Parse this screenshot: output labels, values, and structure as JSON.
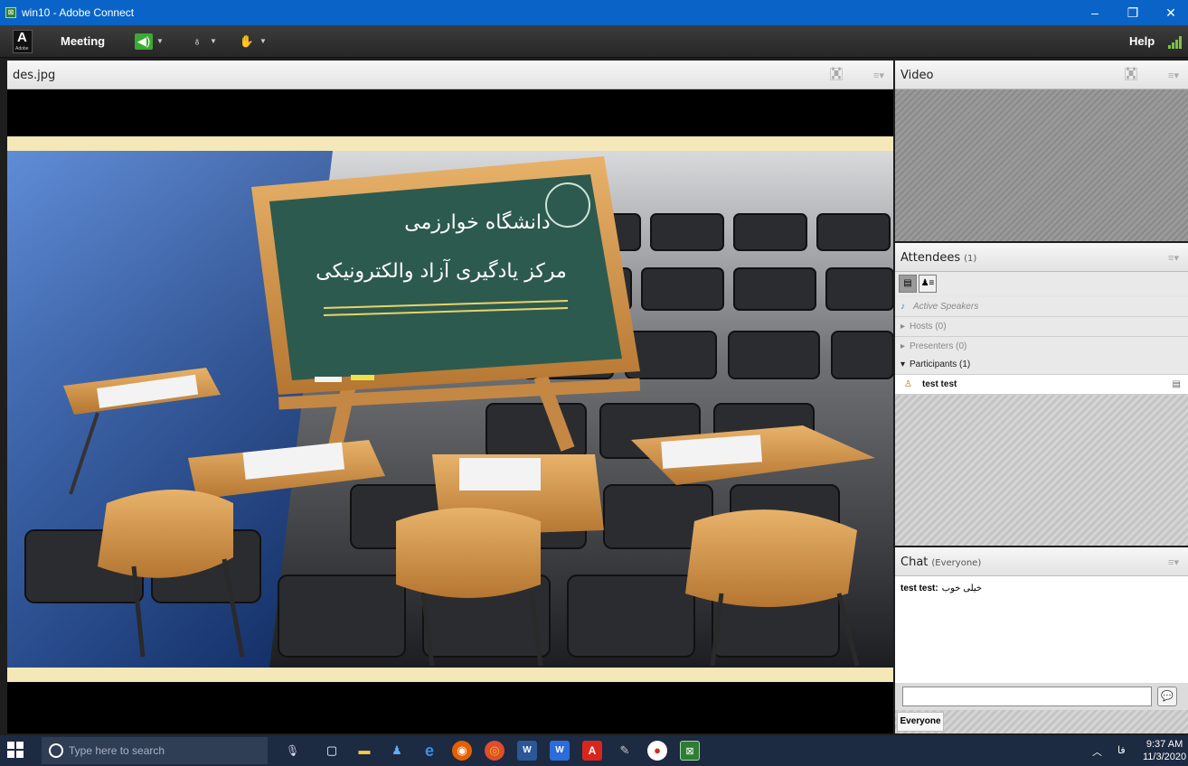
{
  "window": {
    "title": "win10 - Adobe Connect",
    "icons": [
      "minimize-icon",
      "restore-icon",
      "close-icon"
    ]
  },
  "menubar": {
    "logo_letter": "A",
    "logo_sub": "Adobe",
    "meeting_label": "Meeting",
    "speaker_icon": "speaker-icon",
    "mic_icon": "microphone-icon",
    "raise_hand_icon": "raise-hand-icon",
    "help_label": "Help",
    "accent": "#7bc142"
  },
  "share_pod": {
    "title": "des.jpg",
    "slide": {
      "line1": "دانشگاه خوارزمی",
      "line2": "مرکز یادگیری آزاد والکترونیکی"
    }
  },
  "video_pod": {
    "title": "Video"
  },
  "attendees_pod": {
    "title": "Attendees",
    "count": "(1)",
    "active_speakers": "Active Speakers",
    "hosts": "Hosts (0)",
    "presenters": "Presenters (0)",
    "participants": "Participants (1)",
    "attendee_name": "test test"
  },
  "chat_pod": {
    "title": "Chat",
    "scope": "(Everyone)",
    "messages": [
      {
        "sender": "test test:",
        "text": "خیلی خوب"
      }
    ],
    "input_placeholder": "",
    "tab_label": "Everyone"
  },
  "taskbar": {
    "search_placeholder": "Type here to search",
    "language": "فا",
    "time": "9:37 AM",
    "date": "11/3/2020"
  }
}
